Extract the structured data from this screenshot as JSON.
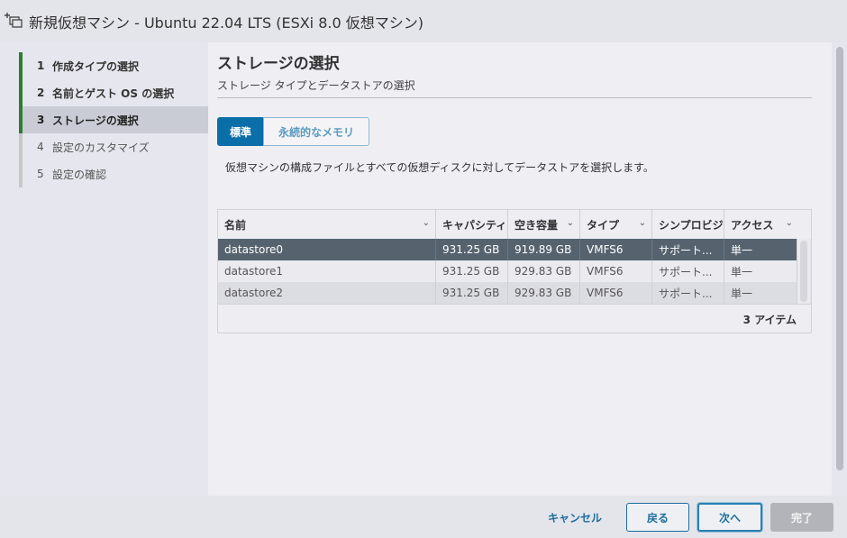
{
  "window": {
    "title": "新規仮想マシン - Ubuntu 22.04 LTS (ESXi 8.0 仮想マシン)",
    "icon": "new-vm-icon"
  },
  "steps": [
    {
      "num": "1",
      "label": "作成タイプの選択",
      "state": "done"
    },
    {
      "num": "2",
      "label": "名前とゲスト OS の選択",
      "state": "done"
    },
    {
      "num": "3",
      "label": "ストレージの選択",
      "state": "active"
    },
    {
      "num": "4",
      "label": "設定のカスタマイズ",
      "state": "pending"
    },
    {
      "num": "5",
      "label": "設定の確認",
      "state": "pending"
    }
  ],
  "main": {
    "title": "ストレージの選択",
    "subtitle": "ストレージ タイプとデータストアの選択",
    "tabs": [
      {
        "label": "標準",
        "selected": true
      },
      {
        "label": "永続的なメモリ",
        "selected": false
      }
    ],
    "description": "仮想マシンの構成ファイルとすべての仮想ディスクに対してデータストアを選択します。"
  },
  "table": {
    "columns": [
      "名前",
      "キャパシティ",
      "空き容量",
      "タイプ",
      "シンプロビジ",
      "アクセス"
    ],
    "rows": [
      [
        "datastore0",
        "931.25 GB",
        "919.89 GB",
        "VMFS6",
        "サポート...",
        "単一"
      ],
      [
        "datastore1",
        "931.25 GB",
        "929.83 GB",
        "VMFS6",
        "サポート...",
        "単一"
      ],
      [
        "datastore2",
        "931.25 GB",
        "929.83 GB",
        "VMFS6",
        "サポート...",
        "単一"
      ]
    ],
    "selected_row": 0,
    "item_count": "3 アイテム"
  },
  "footer": {
    "cancel": "キャンセル",
    "back": "戻る",
    "next": "次へ",
    "finish": "完了"
  },
  "colors": {
    "accent": "#0a6ea8",
    "step_done": "#2e7d32",
    "selected_row": "#56636f"
  }
}
